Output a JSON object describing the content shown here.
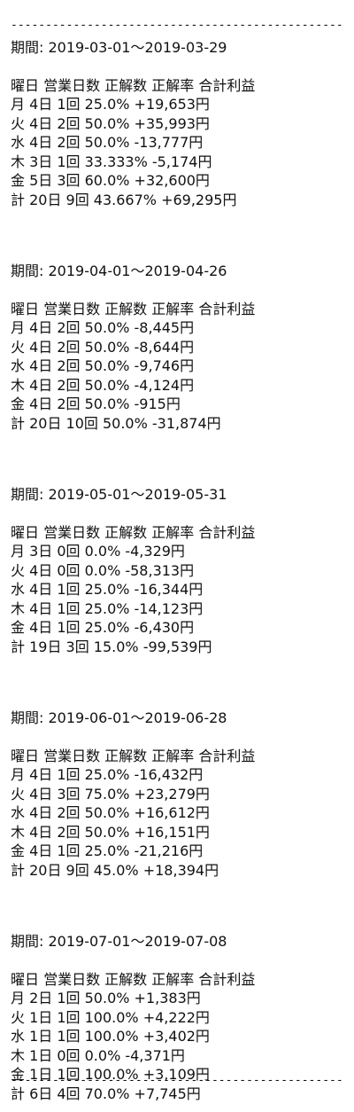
{
  "divider": "------------------------------------------------",
  "blocks": [
    {
      "title": "期間: 2019-03-01～2019-03-29",
      "header": "曜日 営業日数 正解数 正解率 合計利益",
      "rows": [
        "月 4日 1回 25.0% +19,653円",
        "火 4日 2回 50.0% +35,993円",
        "水 4日 2回 50.0% -13,777円",
        "木 3日 1回 33.333% -5,174円",
        "金 5日 3回 60.0% +32,600円",
        "計 20日 9回 43.667% +69,295円"
      ]
    },
    {
      "title": "期間: 2019-04-01～2019-04-26",
      "header": "曜日 営業日数 正解数 正解率 合計利益",
      "rows": [
        "月 4日 2回 50.0% -8,445円",
        "火 4日 2回 50.0% -8,644円",
        "水 4日 2回 50.0% -9,746円",
        "木 4日 2回 50.0% -4,124円",
        "金 4日 2回 50.0% -915円",
        "計 20日 10回 50.0% -31,874円"
      ]
    },
    {
      "title": "期間: 2019-05-01～2019-05-31",
      "header": "曜日 営業日数 正解数 正解率 合計利益",
      "rows": [
        "月 3日 0回 0.0% -4,329円",
        "火 4日 0回 0.0% -58,313円",
        "水 4日 1回 25.0% -16,344円",
        "木 4日 1回 25.0% -14,123円",
        "金 4日 1回 25.0% -6,430円",
        "計 19日 3回 15.0% -99,539円"
      ]
    },
    {
      "title": "期間: 2019-06-01～2019-06-28",
      "header": "曜日 営業日数 正解数 正解率 合計利益",
      "rows": [
        "月 4日 1回 25.0% -16,432円",
        "火 4日 3回 75.0% +23,279円",
        "水 4日 2回 50.0% +16,612円",
        "木 4日 2回 50.0% +16,151円",
        "金 4日 1回 25.0% -21,216円",
        "計 20日 9回 45.0% +18,394円"
      ]
    },
    {
      "title": "期間: 2019-07-01～2019-07-08",
      "header": "曜日 営業日数 正解数 正解率 合計利益",
      "rows": [
        "月 2日 1回 50.0% +1,383円",
        "火 1日 1回 100.0% +4,222円",
        "水 1日 1回 100.0% +3,402円",
        "木 1日 0回 0.0% -4,371円",
        "金 1日 1回 100.0% +3,109円",
        "計 6日 4回 70.0% +7,745円"
      ]
    }
  ]
}
